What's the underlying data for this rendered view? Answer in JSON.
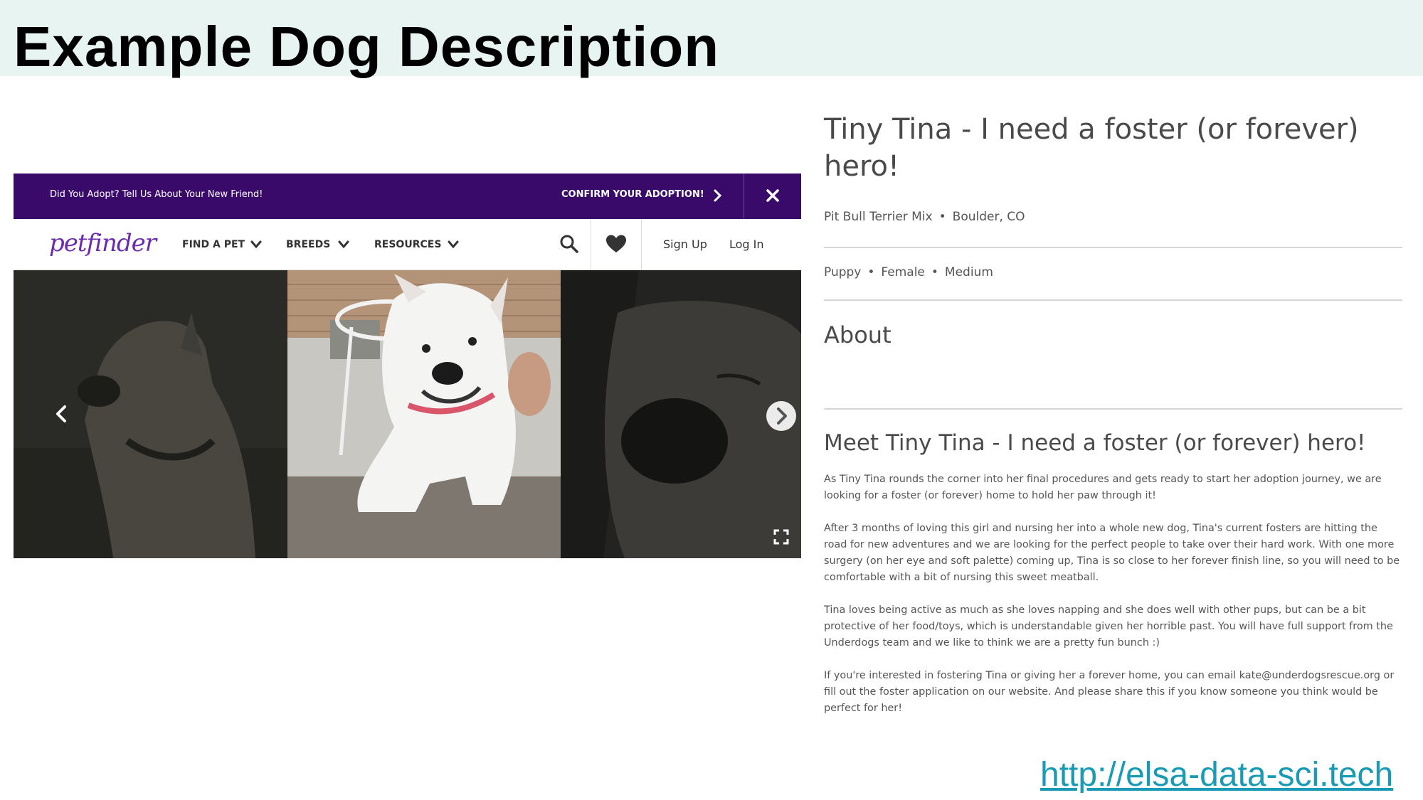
{
  "slide": {
    "title": "Example Dog Description",
    "footer_link": "http://elsa-data-sci.tech"
  },
  "petfinder": {
    "banner": {
      "text": "Did You Adopt? Tell Us About Your New Friend!",
      "cta": "CONFIRM YOUR ADOPTION!",
      "cta_icon": "chevron-right-icon",
      "close_icon": "close-icon"
    },
    "nav": {
      "logo": "petfinder",
      "items": [
        {
          "label": "FIND A PET"
        },
        {
          "label": "BREEDS"
        },
        {
          "label": "RESOURCES"
        }
      ],
      "search_icon": "search-icon",
      "favorites_icon": "heart-icon",
      "sign_up": "Sign Up",
      "log_in": "Log In"
    },
    "carousel": {
      "photos": [
        "dog-photo-dim-left",
        "dog-photo-center",
        "dog-photo-dim-right"
      ],
      "prev_icon": "chevron-left-icon",
      "next_icon": "chevron-right-icon",
      "expand_icon": "expand-icon"
    }
  },
  "listing": {
    "title": "Tiny Tina - I need a foster (or forever) hero!",
    "breed": "Pit Bull Terrier Mix",
    "location": "Boulder, CO",
    "age": "Puppy",
    "sex": "Female",
    "size": "Medium",
    "about_heading": "About",
    "meet_heading": "Meet Tiny Tina - I need a foster (or forever) hero!",
    "paragraphs": [
      "As Tiny Tina rounds the corner into her final procedures and gets ready to start her adoption journey, we are looking for a foster (or forever) home to hold her paw through it!",
      "After 3 months of loving this girl and nursing her into a whole new dog, Tina's current fosters are hitting the road for new adventures and we are looking for the perfect people to take over their hard work. With one more surgery (on her eye and soft palette) coming up, Tina is so close to her forever finish line, so you will need to be comfortable with a bit of nursing this sweet meatball.",
      "Tina loves being active as much as she loves napping and she does well with other pups, but can be a bit protective of her food/toys, which is understandable given her horrible past. You will have full support from the Underdogs team and we like to think we are a pretty fun bunch :)",
      "If you're interested in fostering Tina or giving her a forever home, you can email kate@underdogsrescue.org or fill out the foster application on our website. And please share this if you know someone you think would be perfect for her!"
    ]
  },
  "colors": {
    "banner_bg": "#3a0a6b",
    "logo": "#6a2bb0",
    "link": "#1a9bb5",
    "header_bg": "#e8f4f2"
  }
}
